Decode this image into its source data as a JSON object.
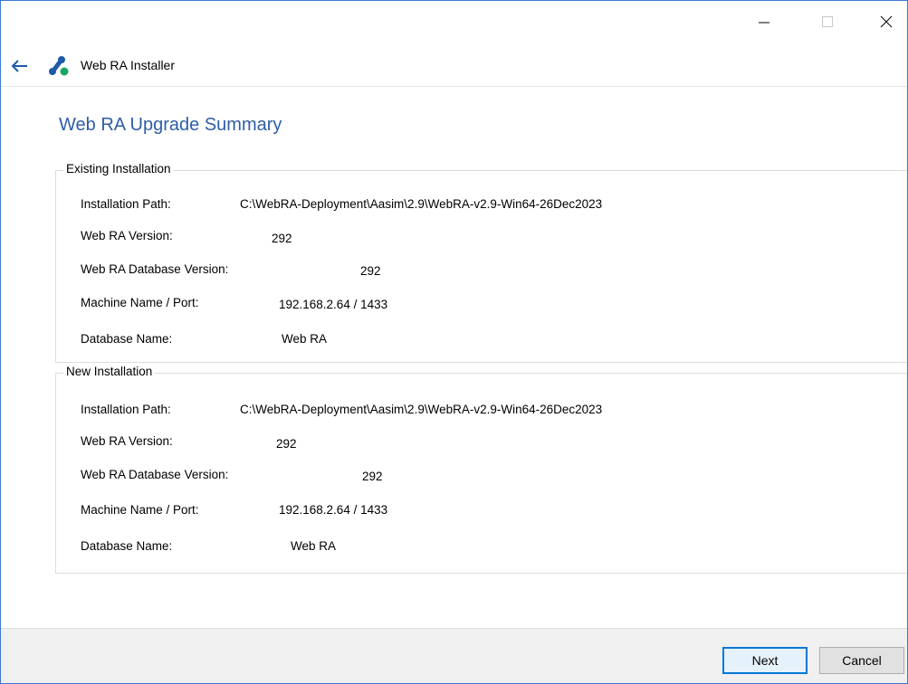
{
  "window": {
    "app_title": "Web RA Installer",
    "controls": {
      "minimize": "minimize",
      "maximize": "maximize",
      "close": "close"
    }
  },
  "page": {
    "title": "Web RA Upgrade Summary"
  },
  "existing": {
    "legend": "Existing Installation",
    "rows": [
      {
        "label": "Installation Path:",
        "value": "C:\\WebRA-Deployment\\Aasim\\2.9\\WebRA-v2.9-Win64-26Dec2023"
      },
      {
        "label": "Web RA Version:",
        "value": "292"
      },
      {
        "label": "Web RA Database Version:",
        "value": "292"
      },
      {
        "label": "Machine Name / Port:",
        "value": "192.168.2.64 / 1433"
      },
      {
        "label": "Database Name:",
        "value": "Web RA"
      }
    ]
  },
  "new": {
    "legend": "New Installation",
    "rows": [
      {
        "label": "Installation Path:",
        "value": "C:\\WebRA-Deployment\\Aasim\\2.9\\WebRA-v2.9-Win64-26Dec2023"
      },
      {
        "label": "Web RA Version:",
        "value": "292"
      },
      {
        "label": "Web RA Database Version:",
        "value": "292"
      },
      {
        "label": "Machine Name / Port:",
        "value": "192.168.2.64 / 1433"
      },
      {
        "label": "Database Name:",
        "value": "Web RA"
      }
    ]
  },
  "footer": {
    "next_label": "Next",
    "cancel_label": "Cancel"
  },
  "colors": {
    "accent": "#2e5da8",
    "border": "#3b78d4",
    "logo_blue": "#1e5aa8",
    "logo_green": "#16a765"
  },
  "icons": {
    "back": "back-arrow-icon",
    "logo": "web-ra-logo-icon"
  }
}
